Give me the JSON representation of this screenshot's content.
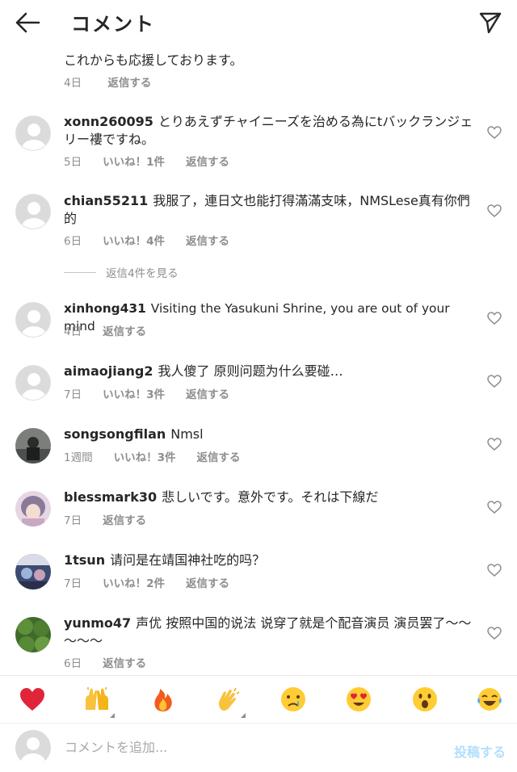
{
  "header": {
    "title": "コメント",
    "back_icon": "arrow-left-icon",
    "send_icon": "paper-plane-icon"
  },
  "caption": {
    "text": "これからも応援しております。",
    "time": "4日",
    "reply": "返信する"
  },
  "comments": [
    {
      "username": "xonn260095",
      "text": "とりあえずチャイニーズを治める為にtバックランジェリー褸ですね。",
      "time": "5日",
      "likes": "いいね！1件",
      "reply": "返信する"
    },
    {
      "username": "chian55211",
      "text": "我服了，連日文也能打得滿滿支味，NMSLese真有你們的",
      "time": "6日",
      "likes": "いいね！4件",
      "reply": "返信する"
    },
    {
      "username": "xinhong431",
      "text": "Visiting the Yasukuni Shrine, you are out of your mind",
      "time": "4日",
      "likes": "",
      "reply": "返信する"
    },
    {
      "username": "aimaojiang2",
      "text": "我人傻了 原则问题为什么要碰…",
      "time": "7日",
      "likes": "いいね！3件",
      "reply": "返信する"
    },
    {
      "username": "songsongfilan",
      "text": "Nmsl",
      "time": "1週間",
      "likes": "いいね！3件",
      "reply": "返信する"
    },
    {
      "username": "blessmark30",
      "text": "悲しいです。意外です。それは下線だ",
      "time": "7日",
      "likes": "",
      "reply": "返信する"
    },
    {
      "username": "1tsun",
      "text": "请问是在靖国神社吃的吗？",
      "time": "7日",
      "likes": "いいね！2件",
      "reply": "返信する"
    },
    {
      "username": "yunmo47",
      "text": "声优  按照中国的说法  说穿了就是个配音演员  演员罢了～～～～～",
      "time": "6日",
      "likes": "",
      "reply": "返信する"
    }
  ],
  "view_replies": "返信4件を見る",
  "emoji_bar": [
    "❤️",
    "🙌",
    "🔥",
    "👏",
    "😢",
    "😍",
    "😮",
    "😂"
  ],
  "input": {
    "placeholder": "コメントを追加...",
    "post_label": "投稿する"
  },
  "colors": {
    "accent": "#b2dffc",
    "muted": "#8e8e8e",
    "text": "#262626"
  }
}
